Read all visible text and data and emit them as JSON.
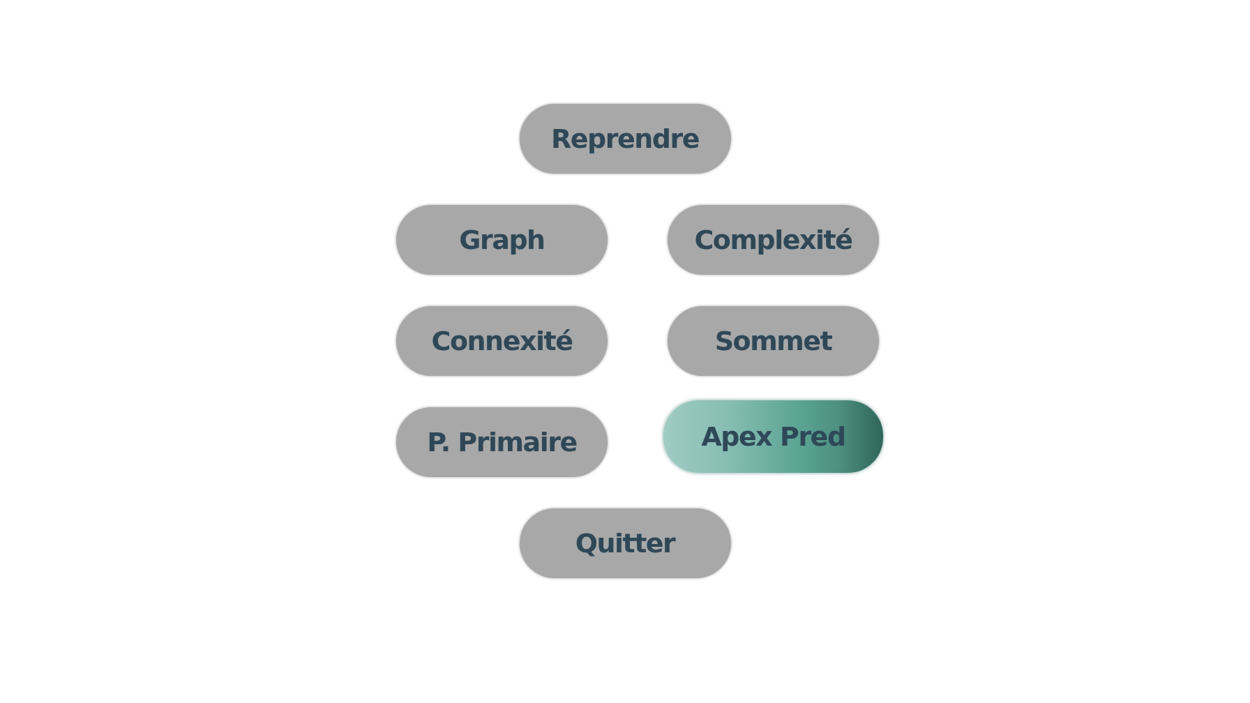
{
  "menu": {
    "buttons": [
      {
        "label": "Reprendre",
        "selected": false
      },
      {
        "label": "Graph",
        "selected": false
      },
      {
        "label": "Complexité",
        "selected": false
      },
      {
        "label": "Connexité",
        "selected": false
      },
      {
        "label": "Sommet",
        "selected": false
      },
      {
        "label": "P. Primaire",
        "selected": false
      },
      {
        "label": "Apex Pred",
        "selected": true
      },
      {
        "label": "Quitter",
        "selected": false
      }
    ]
  }
}
